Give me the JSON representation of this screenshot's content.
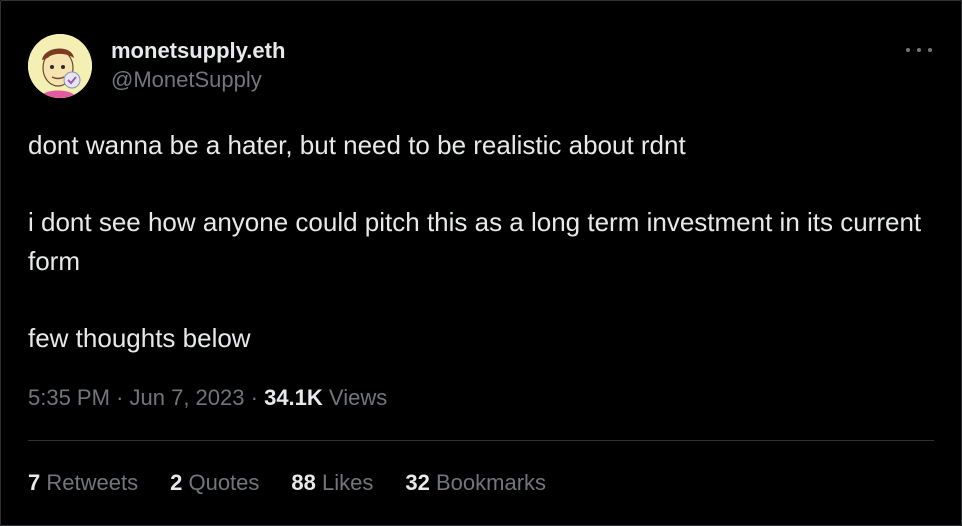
{
  "author": {
    "display_name": "monetsupply.eth",
    "handle": "@MonetSupply"
  },
  "tweet": {
    "lines": [
      "dont wanna be a hater, but need to be realistic about rdnt",
      "i dont see how anyone could pitch this as a long term investment in its current form",
      "few thoughts below"
    ]
  },
  "meta": {
    "time": "5:35 PM",
    "sep1": "·",
    "date": "Jun 7, 2023",
    "sep2": "·",
    "views_count": "34.1K",
    "views_label": "Views"
  },
  "stats": [
    {
      "count": "7",
      "label": "Retweets"
    },
    {
      "count": "2",
      "label": "Quotes"
    },
    {
      "count": "88",
      "label": "Likes"
    },
    {
      "count": "32",
      "label": "Bookmarks"
    }
  ],
  "icons": {
    "more": "more-horizontal-icon"
  },
  "colors": {
    "background": "#000000",
    "text_primary": "#e7e9ea",
    "text_secondary": "#71767b",
    "divider": "#2f3336"
  }
}
